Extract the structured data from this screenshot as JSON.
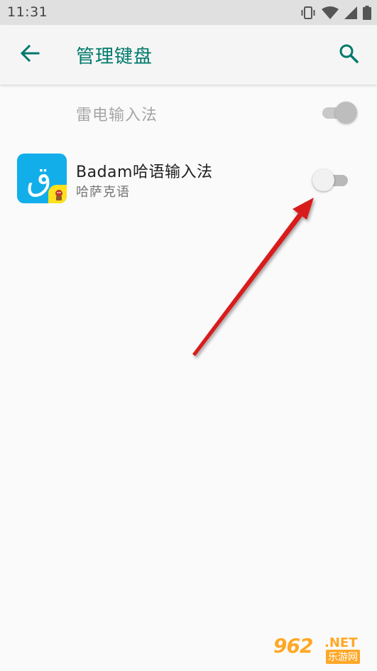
{
  "status_bar": {
    "time": "11:31",
    "icons": [
      "vibrate-icon",
      "wifi-icon",
      "cell-signal-icon",
      "battery-icon"
    ]
  },
  "app_bar": {
    "title": "管理键盘",
    "back_icon": "arrow-left-icon",
    "search_icon": "search-icon",
    "accent": "#00796b"
  },
  "keyboards": [
    {
      "label": "雷电输入法",
      "enabled": true,
      "disabled_state": true
    },
    {
      "label": "Badam哈语输入法",
      "sublabel": "哈萨克语",
      "icon_glyph": "ق",
      "enabled": false
    }
  ],
  "annotation": {
    "type": "red-arrow",
    "color": "#d81b1b"
  },
  "watermark": {
    "number": "962",
    "suffix": ".NET",
    "label": "乐游网"
  }
}
